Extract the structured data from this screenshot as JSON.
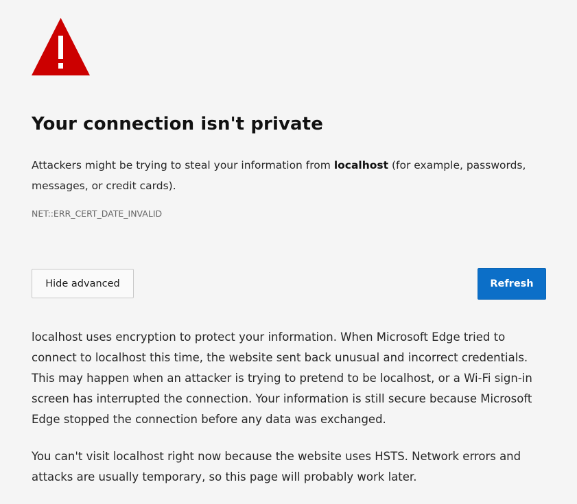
{
  "icon": {
    "name": "warning-triangle-icon",
    "color": "#cc0000",
    "glyph": "!"
  },
  "heading": "Your connection isn't private",
  "summary": {
    "before": "Attackers might be trying to steal your information from ",
    "host": "localhost",
    "after": " (for example, passwords, messages, or credit cards)."
  },
  "error_code": "NET::ERR_CERT_DATE_INVALID",
  "buttons": {
    "hide_advanced": "Hide advanced",
    "refresh": "Refresh"
  },
  "details": "localhost uses encryption to protect your information. When Microsoft Edge tried to connect to localhost this time, the website sent back unusual and incorrect credentials. This may happen when an attacker is trying to pretend to be localhost, or a Wi-Fi sign-in screen has interrupted the connection. Your information is still secure because Microsoft Edge stopped the connection before any data was exchanged.",
  "hsts_note": "You can't visit localhost right now because the website uses HSTS. Network errors and attacks are usually temporary, so this page will probably work later.",
  "colors": {
    "background": "#f5f5f5",
    "accent": "#0c6fc8",
    "warning": "#cc0000"
  }
}
